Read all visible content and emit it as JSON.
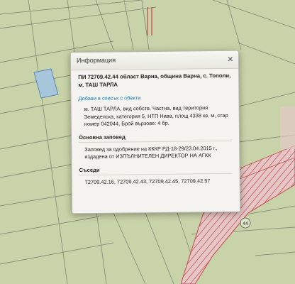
{
  "popup": {
    "header_title": "Информация",
    "close_label": "×",
    "title": "ПИ 72709.42.44 област Варна, община Варна, с. Тополи, м. ТАШ ТАРЛА",
    "add_link": "Добави в списък с обекти",
    "description": "м. ТАШ ТАРЛА, вид собств. Частна, вид територия Земеделска, категория 5, НТП Нива, площ 4338 кв. м, стар номер 042044, Брой вързове: 4 бр.",
    "order_heading": "Основна заповед",
    "order_text": "Заповед за одобрение на КККР РД-18-29/23.04.2015 г., издадена от ИЗПЪЛНИТЕЛЕН ДИРЕКТОР НА АГКК",
    "neighbours_heading": "Съседи",
    "neighbours_text": "72709.42.16, 72709.42.43, 72709.42.45, 72709.42.57"
  },
  "map": {
    "parcel_label": "44",
    "colors": {
      "background": "#c9d3a9",
      "selected_parcel": "#a7c6dc",
      "hatch": "#c24a4a",
      "line": "#8a8f7a"
    }
  }
}
